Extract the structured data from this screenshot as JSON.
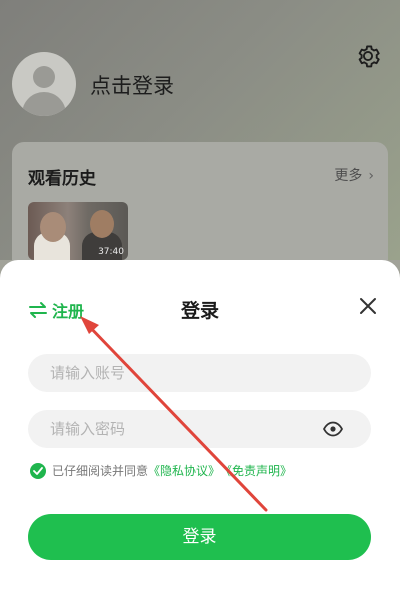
{
  "profile": {
    "login_prompt": "点击登录"
  },
  "history": {
    "title": "观看历史",
    "more_label": "更多",
    "item_duration": "37:40"
  },
  "login_sheet": {
    "register_label": "注册",
    "title": "登录",
    "account_placeholder": "请输入账号",
    "password_placeholder": "请输入密码",
    "agree_text": "已仔细阅读并同意",
    "privacy_link": "《隐私协议》",
    "disclaimer_link": "《免责声明》",
    "login_button": "登录"
  },
  "colors": {
    "accent_green": "#1fbf4f",
    "annotation_red": "#e0453b"
  },
  "icons": [
    "gear-icon",
    "swap-icon",
    "close-icon",
    "eye-icon",
    "check-icon",
    "chevron-right-icon"
  ]
}
